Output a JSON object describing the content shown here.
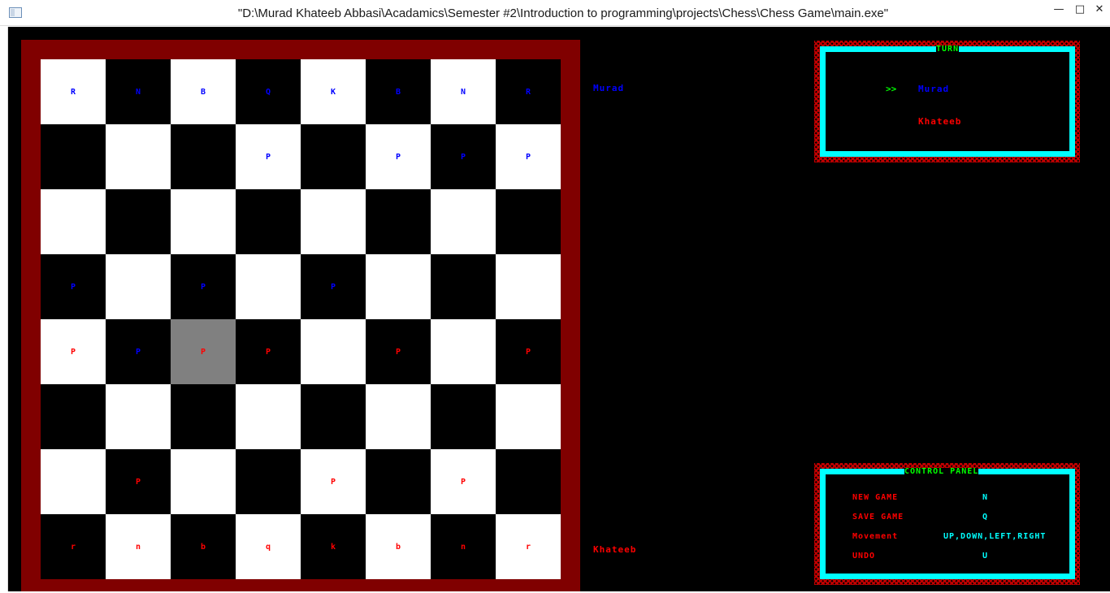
{
  "window": {
    "title": "\"D:\\Murad Khateeb Abbasi\\Acadamics\\Semester #2\\Introduction to programming\\projects\\Chess\\Chess Game\\main.exe\"",
    "minimize": "—",
    "maximize": "□",
    "close": "✕"
  },
  "players": {
    "top": "Murad",
    "bottom": "Khateeb"
  },
  "board": {
    "selected_square": "c4",
    "rows": [
      [
        {
          "p": "R",
          "c": "blue"
        },
        {
          "p": "N",
          "c": "blue"
        },
        {
          "p": "B",
          "c": "blue"
        },
        {
          "p": "Q",
          "c": "blue"
        },
        {
          "p": "K",
          "c": "blue"
        },
        {
          "p": "B",
          "c": "blue"
        },
        {
          "p": "N",
          "c": "blue"
        },
        {
          "p": "R",
          "c": "blue"
        }
      ],
      [
        {
          "p": "",
          "c": ""
        },
        {
          "p": "",
          "c": ""
        },
        {
          "p": "",
          "c": ""
        },
        {
          "p": "P",
          "c": "blue"
        },
        {
          "p": "",
          "c": ""
        },
        {
          "p": "P",
          "c": "blue"
        },
        {
          "p": "P",
          "c": "blue"
        },
        {
          "p": "P",
          "c": "blue"
        }
      ],
      [
        {
          "p": "",
          "c": ""
        },
        {
          "p": "",
          "c": ""
        },
        {
          "p": "",
          "c": ""
        },
        {
          "p": "",
          "c": ""
        },
        {
          "p": "",
          "c": ""
        },
        {
          "p": "",
          "c": ""
        },
        {
          "p": "",
          "c": ""
        },
        {
          "p": "",
          "c": ""
        }
      ],
      [
        {
          "p": "P",
          "c": "blue"
        },
        {
          "p": "",
          "c": ""
        },
        {
          "p": "P",
          "c": "blue"
        },
        {
          "p": "",
          "c": ""
        },
        {
          "p": "P",
          "c": "blue"
        },
        {
          "p": "",
          "c": ""
        },
        {
          "p": "",
          "c": ""
        },
        {
          "p": "",
          "c": ""
        }
      ],
      [
        {
          "p": "P",
          "c": "red"
        },
        {
          "p": "P",
          "c": "blue"
        },
        {
          "p": "P",
          "c": "red"
        },
        {
          "p": "P",
          "c": "red"
        },
        {
          "p": "",
          "c": ""
        },
        {
          "p": "P",
          "c": "red"
        },
        {
          "p": "",
          "c": ""
        },
        {
          "p": "P",
          "c": "red"
        }
      ],
      [
        {
          "p": "",
          "c": ""
        },
        {
          "p": "",
          "c": ""
        },
        {
          "p": "",
          "c": ""
        },
        {
          "p": "",
          "c": ""
        },
        {
          "p": "",
          "c": ""
        },
        {
          "p": "",
          "c": ""
        },
        {
          "p": "",
          "c": ""
        },
        {
          "p": "",
          "c": ""
        }
      ],
      [
        {
          "p": "",
          "c": ""
        },
        {
          "p": "P",
          "c": "red"
        },
        {
          "p": "",
          "c": ""
        },
        {
          "p": "",
          "c": ""
        },
        {
          "p": "P",
          "c": "red"
        },
        {
          "p": "",
          "c": ""
        },
        {
          "p": "P",
          "c": "red"
        },
        {
          "p": "",
          "c": ""
        }
      ],
      [
        {
          "p": "r",
          "c": "red"
        },
        {
          "p": "n",
          "c": "red"
        },
        {
          "p": "b",
          "c": "red"
        },
        {
          "p": "q",
          "c": "red"
        },
        {
          "p": "k",
          "c": "red"
        },
        {
          "p": "b",
          "c": "red"
        },
        {
          "p": "n",
          "c": "red"
        },
        {
          "p": "r",
          "c": "red"
        }
      ]
    ]
  },
  "turn_panel": {
    "title": "TURN",
    "indicator": ">>",
    "player1": "Murad",
    "player2": "Khateeb"
  },
  "control_panel": {
    "title": "CONTROL PANEL",
    "items": [
      {
        "label": "NEW GAME",
        "key": "N"
      },
      {
        "label": "SAVE GAME",
        "key": "Q"
      },
      {
        "label": "Movement",
        "key": "UP,DOWN,LEFT,RIGHT"
      },
      {
        "label": "UNDO",
        "key": "U"
      }
    ]
  },
  "colors": {
    "board_frame": "#800000",
    "light_square": "#ffffff",
    "dark_square": "#000000",
    "selected_square": "#808080",
    "player1_pieces": "#0000ff",
    "player2_pieces": "#ff0000",
    "panel_border": "#00ffff",
    "panel_title": "#00ff00",
    "hatch": "#c00000"
  }
}
